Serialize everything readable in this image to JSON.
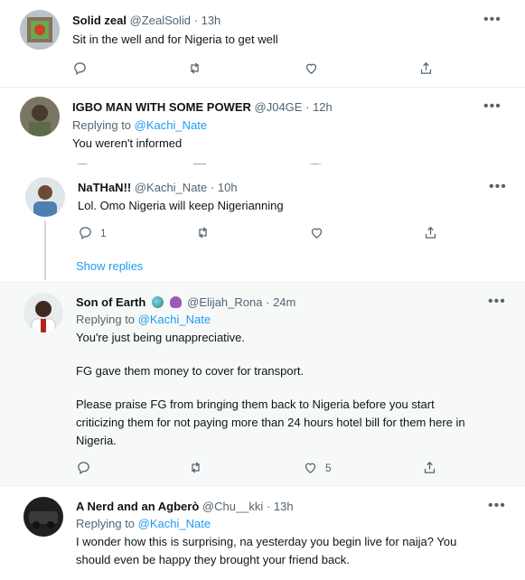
{
  "tweets": [
    {
      "name": "Solid zeal",
      "handle": "@ZealSolid",
      "dot": "·",
      "time": "13h",
      "text": "Sit in the well and for Nigeria to get well",
      "more": "•••"
    },
    {
      "name": "IGBO MAN WITH SOME POWER",
      "handle": "@J04GE",
      "dot": "·",
      "time": "12h",
      "replying_prefix": "Replying to",
      "replying_to": "@Kachi_Nate",
      "text": "You weren't informed",
      "more": "•••"
    },
    {
      "name": "NaTHaN!!",
      "handle": "@Kachi_Nate",
      "dot": "·",
      "time": "10h",
      "text": "Lol. Omo Nigeria will keep Nigerianning",
      "reply_count": "1",
      "more": "•••",
      "show_replies": "Show replies"
    },
    {
      "name": "Son of Earth",
      "handle": "@Elijah_Rona",
      "dot": "·",
      "time": "24m",
      "replying_prefix": "Replying to",
      "replying_to": "@Kachi_Nate",
      "text_lines": [
        "You're just being unappreciative.",
        "",
        "FG gave them money to cover for transport.",
        "",
        "Please praise FG from bringing them back to Nigeria before you start",
        "criticizing them for not paying more than 24 hours hotel bill for them here in",
        "Nigeria."
      ],
      "like_count": "5",
      "more": "•••"
    },
    {
      "name": "A Nerd and an Agberò",
      "handle": "@Chu__kki",
      "dot": "·",
      "time": "13h",
      "replying_prefix": "Replying to",
      "replying_to": "@Kachi_Nate",
      "text_lines": [
        "I wonder how this is surprising, na yesterday you begin live for naija? You",
        "should even be happy they brought your friend back."
      ],
      "more": "•••"
    }
  ],
  "icons": [
    "reply-icon",
    "retweet-icon",
    "like-icon",
    "share-icon",
    "more-icon"
  ],
  "colors": {
    "accent": "#1d9bf0",
    "muted": "#536471",
    "text": "#0f1419",
    "divider": "#e6ecf0",
    "highlight_bg": "#f7f9f9"
  }
}
